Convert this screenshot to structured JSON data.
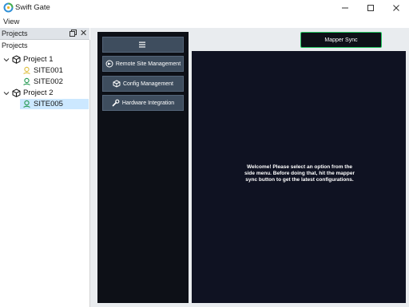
{
  "window": {
    "title": "Swift Gate",
    "controls": [
      "minimize",
      "maximize",
      "close"
    ]
  },
  "menubar": {
    "items": [
      {
        "label": "View"
      }
    ]
  },
  "projects_dock": {
    "title": "Projects",
    "tree_header": "Projects",
    "tree": [
      {
        "label": "Project 1",
        "expanded": true,
        "icon": "project-cube-icon",
        "children": [
          {
            "label": "SITE001",
            "icon": "location-pin-icon",
            "icon_color": "#e0c34a"
          },
          {
            "label": "SITE002",
            "icon": "location-pin-icon",
            "icon_color": "#2e9e5a"
          }
        ]
      },
      {
        "label": "Project 2",
        "expanded": true,
        "icon": "project-cube-icon",
        "children": [
          {
            "label": "SITE005",
            "icon": "location-pin-icon",
            "icon_color": "#2e9e5a",
            "selected": true
          }
        ]
      }
    ]
  },
  "side_menu": {
    "hamburger_icon": "hamburger-menu-icon",
    "buttons": [
      {
        "label": "Remote Site Management",
        "icon": "remote-icon"
      },
      {
        "label": "Config Management",
        "icon": "cube-icon"
      },
      {
        "label": "Hardware Integration",
        "icon": "wrench-icon"
      }
    ]
  },
  "header": {
    "mapper_sync_label": "Mapper Sync"
  },
  "content": {
    "welcome": "Welcome! Please select an option from the side menu. Before doing that, hit the mapper sync button to get the latest configurations."
  },
  "colors": {
    "dark_panel": "#0d1017",
    "content_bg": "#0f1222",
    "menu_button": "#3e4d5e",
    "accent_green": "#22c55e",
    "selection": "#cce8ff"
  }
}
